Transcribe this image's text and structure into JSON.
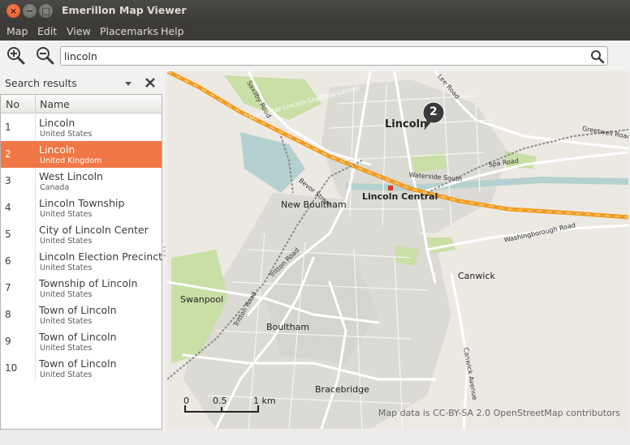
{
  "window": {
    "title": "Emerillon Map Viewer"
  },
  "menubar": {
    "items": [
      "Map",
      "Edit",
      "View",
      "Placemarks",
      "Help"
    ]
  },
  "toolbar": {
    "search_value": "lincoln"
  },
  "sidebar": {
    "header": "Search results",
    "columns": {
      "no": "No",
      "name": "Name"
    },
    "results": [
      {
        "no": "1",
        "name": "Lincoln",
        "country": "United States"
      },
      {
        "no": "2",
        "name": "Lincoln",
        "country": "United Kingdom",
        "selected": true
      },
      {
        "no": "3",
        "name": "West Lincoln",
        "country": "Canada"
      },
      {
        "no": "4",
        "name": "Lincoln Township",
        "country": "United States"
      },
      {
        "no": "5",
        "name": "City of Lincoln Center",
        "country": "United States"
      },
      {
        "no": "6",
        "name": "Lincoln Election Precinct",
        "country": "United States"
      },
      {
        "no": "7",
        "name": "Township of Lincoln",
        "country": "United States"
      },
      {
        "no": "8",
        "name": "Town of Lincoln",
        "country": "United States"
      },
      {
        "no": "9",
        "name": "Town of Lincoln",
        "country": "United States"
      },
      {
        "no": "10",
        "name": "Town of Lincoln",
        "country": "United States"
      }
    ]
  },
  "map": {
    "marker_number": "2",
    "places": {
      "lincoln": "Lincoln",
      "lincoln_central": "Lincoln Central",
      "new_boultham": "New Boultham",
      "swanpool": "Swanpool",
      "boultham": "Boultham",
      "canwick": "Canwick",
      "bracebridge": "Bracebridge"
    },
    "roads": {
      "saxilby": "Saxilby Road",
      "lee": "Lee Road",
      "greetwell": "Greetwell Road",
      "spa": "Spa Road",
      "waterside": "Waterside South",
      "beevor": "Bevor Street",
      "washingborough": "Washingborough Road",
      "tritton1": "Tritton Road",
      "tritton2": "Tritton Road",
      "canwick_ave": "Canwick Avenue",
      "railway": "Doncaster-Lincoln-Sheffield-Lincoln"
    },
    "scale": {
      "zero": "0",
      "half": "0.5",
      "one": "1 km"
    },
    "attribution": "Map data is CC-BY-SA 2.0 OpenStreetMap contributors",
    "colors": {
      "railway": "#f39a1d",
      "water": "#b5d0d0",
      "park": "#c8dfa6",
      "urban": "#dcdad4"
    }
  }
}
